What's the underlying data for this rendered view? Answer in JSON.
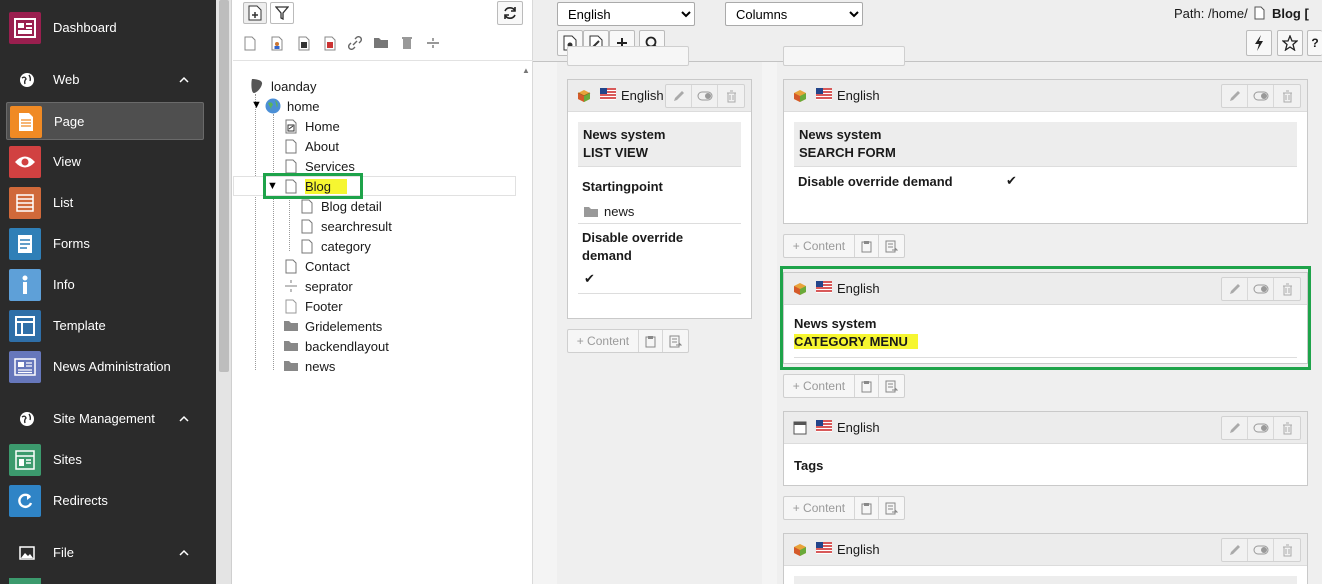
{
  "module_menu": {
    "dashboard": "Dashboard",
    "web_group": "Web",
    "web_items": [
      "Page",
      "View",
      "List",
      "Forms",
      "Info",
      "Template",
      "News Administration"
    ],
    "site_group": "Site Management",
    "site_items": [
      "Sites",
      "Redirects"
    ],
    "file_group": "File"
  },
  "colors": {
    "dashboard": "#9a1f4f",
    "page": "#f08a24",
    "view": "#d14141",
    "list": "#d0693a",
    "forms": "#2f7fb7",
    "info": "#5ea0d8",
    "template": "#2f6fa8",
    "news": "#6677bb",
    "sites": "#3c9a6d",
    "redirects": "#2f84c6",
    "highlight_green": "#1ea34a",
    "highlight_yellow": "#f6f631"
  },
  "tree": {
    "root": "loanday",
    "home": "home",
    "pages": [
      "Home",
      "About",
      "Services"
    ],
    "blog": "Blog",
    "blog_children": [
      "Blog detail",
      "searchresult",
      "category"
    ],
    "after_blog": [
      "Contact",
      "seprator",
      "Footer",
      "Gridelements",
      "backendlayout",
      "news"
    ]
  },
  "docheader": {
    "language": "English",
    "view_mode": "Columns",
    "path_label": "Path: /home/",
    "path_page": "Blog ["
  },
  "content": {
    "lang": "English",
    "add_content": "+ Content",
    "left_ce": {
      "type_line1": "News system",
      "type_line2": "LIST VIEW",
      "startingpoint_label": "Startingpoint",
      "startingpoint_value": "news",
      "override_label_1": "Disable override",
      "override_label_2": "demand",
      "check": "✔"
    },
    "right_ce1": {
      "type_line1": "News system",
      "type_line2": "SEARCH FORM",
      "override_label": "Disable override demand",
      "check": "✔"
    },
    "right_ce2": {
      "type_line1": "News system",
      "type_line2": "CATEGORY MENU"
    },
    "right_ce3": {
      "title": "Tags"
    }
  }
}
